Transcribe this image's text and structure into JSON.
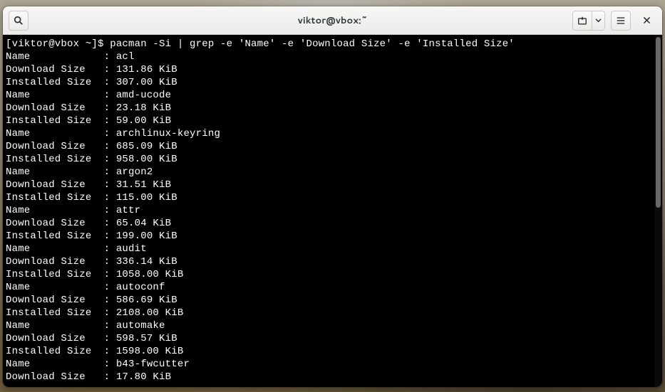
{
  "window": {
    "title": "viktor@vbox:~"
  },
  "terminal": {
    "prompt": "[viktor@vbox ~]$ ",
    "command": "pacman -Si | grep -e 'Name' -e 'Download Size' -e 'Installed Size'",
    "packages": [
      {
        "name": "acl",
        "download": "131.86 KiB",
        "installed": "307.00 KiB"
      },
      {
        "name": "amd-ucode",
        "download": "23.18 KiB",
        "installed": "59.00 KiB"
      },
      {
        "name": "archlinux-keyring",
        "download": "685.09 KiB",
        "installed": "958.00 KiB"
      },
      {
        "name": "argon2",
        "download": "31.51 KiB",
        "installed": "115.00 KiB"
      },
      {
        "name": "attr",
        "download": "65.04 KiB",
        "installed": "199.00 KiB"
      },
      {
        "name": "audit",
        "download": "336.14 KiB",
        "installed": "1058.00 KiB"
      },
      {
        "name": "autoconf",
        "download": "586.69 KiB",
        "installed": "2108.00 KiB"
      },
      {
        "name": "automake",
        "download": "598.57 KiB",
        "installed": "1598.00 KiB"
      },
      {
        "name": "b43-fwcutter",
        "download": "17.80 KiB",
        "installed": ""
      }
    ],
    "labels": {
      "name": "Name",
      "download": "Download Size",
      "installed": "Installed Size"
    }
  }
}
